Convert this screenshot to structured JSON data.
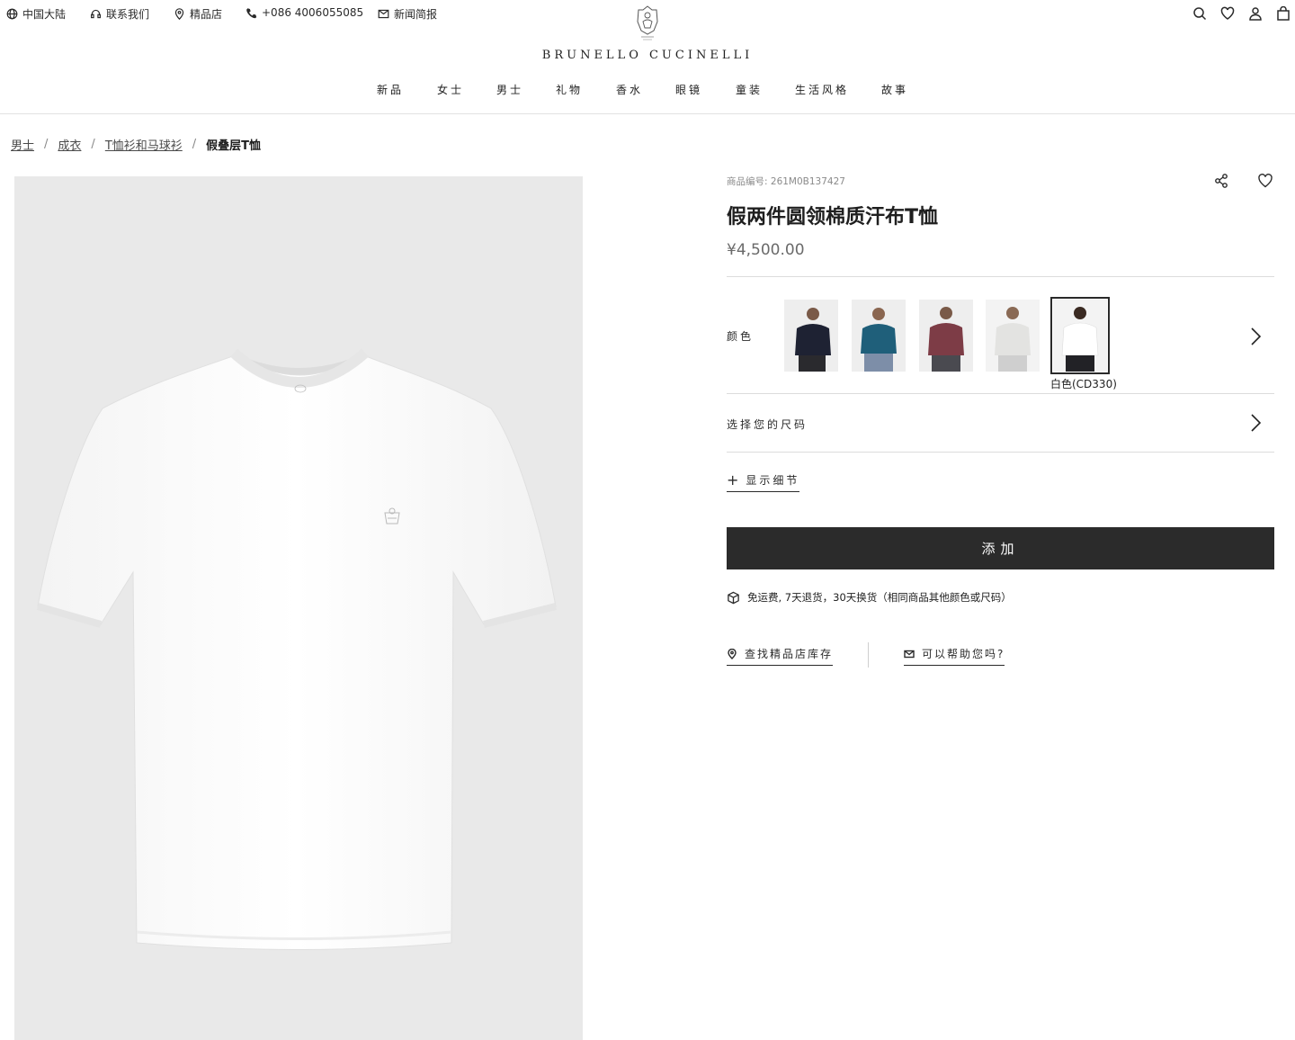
{
  "header": {
    "utility": {
      "region": "中国大陆",
      "contact": "联系我们",
      "store": "精品店",
      "phone": "+086 4006055085",
      "news": "新闻简报"
    },
    "brand": "BRUNELLO CUCINELLI",
    "nav": [
      "新品",
      "女士",
      "男士",
      "礼物",
      "香水",
      "眼镜",
      "童装",
      "生活风格",
      "故事"
    ],
    "right_icons": [
      "search-icon",
      "heart-icon",
      "user-icon",
      "bag-icon"
    ]
  },
  "breadcrumb": {
    "items": [
      "男士",
      "成衣",
      "T恤衫和马球衫"
    ],
    "separator": "/",
    "current": "假叠层T恤"
  },
  "product": {
    "sku_label": "商品编号:",
    "sku": "261M0B137427",
    "title": "假两件圆领棉质汗布T恤",
    "price": "¥4,500.00",
    "color_label": "颜色",
    "colors": [
      {
        "name": "navy",
        "hex": "#1e2233"
      },
      {
        "name": "teal",
        "hex": "#1f5f7a"
      },
      {
        "name": "burgundy",
        "hex": "#7d3c46"
      },
      {
        "name": "light-grey",
        "hex": "#ececea"
      },
      {
        "name": "white",
        "hex": "#f7f7f7"
      }
    ],
    "selected_color": "白色(CD330)",
    "size_label": "选择您的尺码",
    "details_label": "显示细节",
    "add_button": "添加",
    "shipping": "免运费, 7天退货，30天换货（相同商品其他颜色或尺码）",
    "store_stock": "查找精品店库存",
    "help": "可以帮助您吗?"
  },
  "colors": {
    "button_bg": "#2b2b2b",
    "image_bg": "#e9e9e9",
    "text": "#1f1f1f"
  }
}
